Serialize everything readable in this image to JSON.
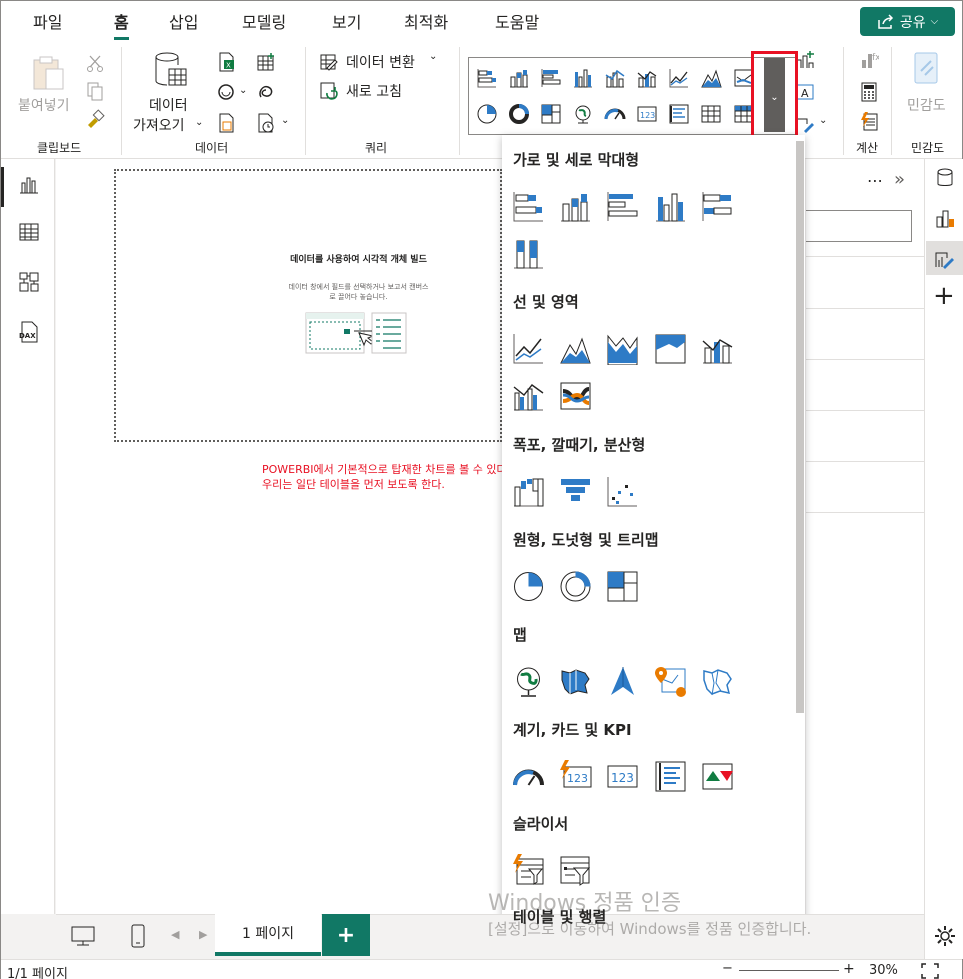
{
  "menu": {
    "tabs": [
      "파일",
      "홈",
      "삽입",
      "모델링",
      "보기",
      "최적화",
      "도움말"
    ],
    "share_label": "공유"
  },
  "ribbon": {
    "paste_label": "붙여넣기",
    "clipboard_group": "클립보드",
    "get_data_line1": "데이터",
    "get_data_line2": "가져오기",
    "data_group": "데이터",
    "transform_label": "데이터 변환",
    "refresh_label": "새로 고침",
    "query_group": "쿼리",
    "calc_group": "계산",
    "sensitivity_label": "민감도",
    "sensitivity_group": "민감도"
  },
  "canvas": {
    "placeholder_title": "데이터를 사용하여 시각적 개체 빌드",
    "placeholder_desc": "데이터 창에서 필드를 선택하거나 보고서 캔버스로 끌어다 놓습니다.",
    "note_line1": "POWERBI에서 기본적으로 탑재한 차트를 볼 수 있다.",
    "note_line2": "우리는 일단 테이블을 먼저 보도록 한다."
  },
  "visual_gallery": {
    "categories": [
      "가로 및 세로 막대형",
      "선 및 영역",
      "폭포, 깔때기, 분산형",
      "원형, 도넛형 및 트리맵",
      "맵",
      "계기, 카드 및 KPI",
      "슬라이서",
      "테이블 및 행렬"
    ]
  },
  "pages": {
    "page1_label": "1 페이지",
    "add_label": "+"
  },
  "status": {
    "page_info": "1/1 페이지",
    "zoom": "30%"
  },
  "watermark": {
    "line1": "Windows 정품 인증",
    "line2": "[설정]으로 이동하여 Windows를 정품 인증합니다."
  },
  "colors": {
    "accent": "#117865",
    "highlight": "#e81123",
    "icon_blue": "#2e7bc6"
  }
}
